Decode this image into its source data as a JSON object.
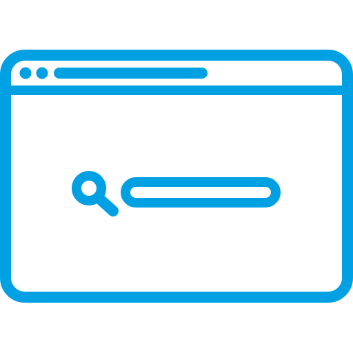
{
  "icon": {
    "name": "browser-search-icon",
    "stroke_color": "#00A0E3",
    "background_color": "#FFFFFF",
    "parts": {
      "window": "browser-window-icon",
      "window_dots": [
        "window-dot-icon",
        "window-dot-icon"
      ],
      "address_bar": "address-bar-icon",
      "magnifier": "search-icon",
      "search_field": "search-field-icon"
    }
  }
}
